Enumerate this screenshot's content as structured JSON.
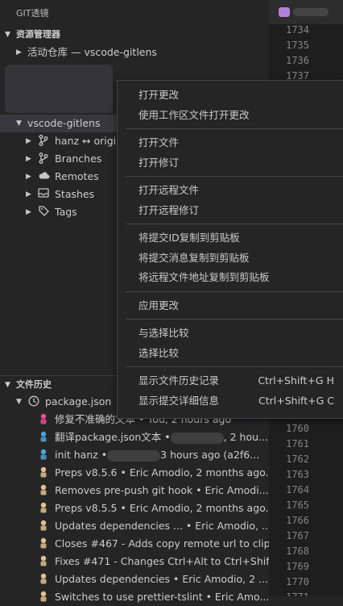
{
  "titlebar": {
    "title": "GIT透镜"
  },
  "editor": {
    "lines_top": [
      "1734",
      "1735",
      "1736",
      "1737"
    ],
    "lines_bottom": [
      "1760",
      "1761",
      "1762",
      "1763",
      "1764",
      "1765",
      "1766",
      "1767",
      "1768",
      "1769",
      "1770",
      "1771"
    ]
  },
  "explorer": {
    "header": "资源管理器",
    "active_repo": "活动仓库 — vscode-gitlens"
  },
  "repo": {
    "name": "vscode-gitlens",
    "branch": "hanz ↔ origi",
    "items": [
      "Branches",
      "Remotes",
      "Stashes",
      "Tags"
    ]
  },
  "file_history": {
    "header": "文件历史",
    "file": "package.json",
    "commits": [
      {
        "text": "修复不准确的文本 • You, 2 hours ago",
        "color": "#e94d8a"
      },
      {
        "text": "翻译package.json文本 •",
        "suffix": ", 2 hou...",
        "color": "#4fa3d1"
      },
      {
        "text": "init hanz •",
        "suffix": "3 hours ago  (a2f6...",
        "color": "#4fa3d1"
      },
      {
        "text": "Preps v8.5.6 • Eric Amodio, 2 months ago...",
        "color": "#e2c08d"
      },
      {
        "text": "Removes pre-push git hook • Eric Amodi...",
        "color": "#e2c08d"
      },
      {
        "text": "Preps v8.5.5 • Eric Amodio, 2 months ago...",
        "color": "#e2c08d"
      },
      {
        "text": "Updates dependencies ... • Eric Amodio, ...",
        "color": "#e2c08d"
      },
      {
        "text": "Closes #467 - Adds copy remote url to clip...",
        "color": "#e2c08d"
      },
      {
        "text": "Fixes #471 - Changes Ctrl+Alt to Ctrl+Shift...",
        "color": "#e2c08d"
      },
      {
        "text": "Updates dependencies • Eric Amodio, 2 ...",
        "color": "#e2c08d"
      },
      {
        "text": "Switches to use prettier-tslint • Eric Amo...",
        "color": "#e2c08d"
      }
    ]
  },
  "context_menu": {
    "groups": [
      [
        {
          "label": "打开更改"
        },
        {
          "label": "使用工作区文件打开更改"
        }
      ],
      [
        {
          "label": "打开文件"
        },
        {
          "label": "打开修订"
        }
      ],
      [
        {
          "label": "打开远程文件"
        },
        {
          "label": "打开远程修订"
        }
      ],
      [
        {
          "label": "将提交ID复制到剪贴板"
        },
        {
          "label": "将提交消息复制到剪贴板"
        },
        {
          "label": "将远程文件地址复制到剪贴板"
        }
      ],
      [
        {
          "label": "应用更改"
        }
      ],
      [
        {
          "label": "与选择比较"
        },
        {
          "label": "选择比较"
        }
      ],
      [
        {
          "label": "显示文件历史记录",
          "shortcut": "Ctrl+Shift+G H"
        },
        {
          "label": "显示提交详细信息",
          "shortcut": "Ctrl+Shift+G C"
        }
      ]
    ]
  }
}
